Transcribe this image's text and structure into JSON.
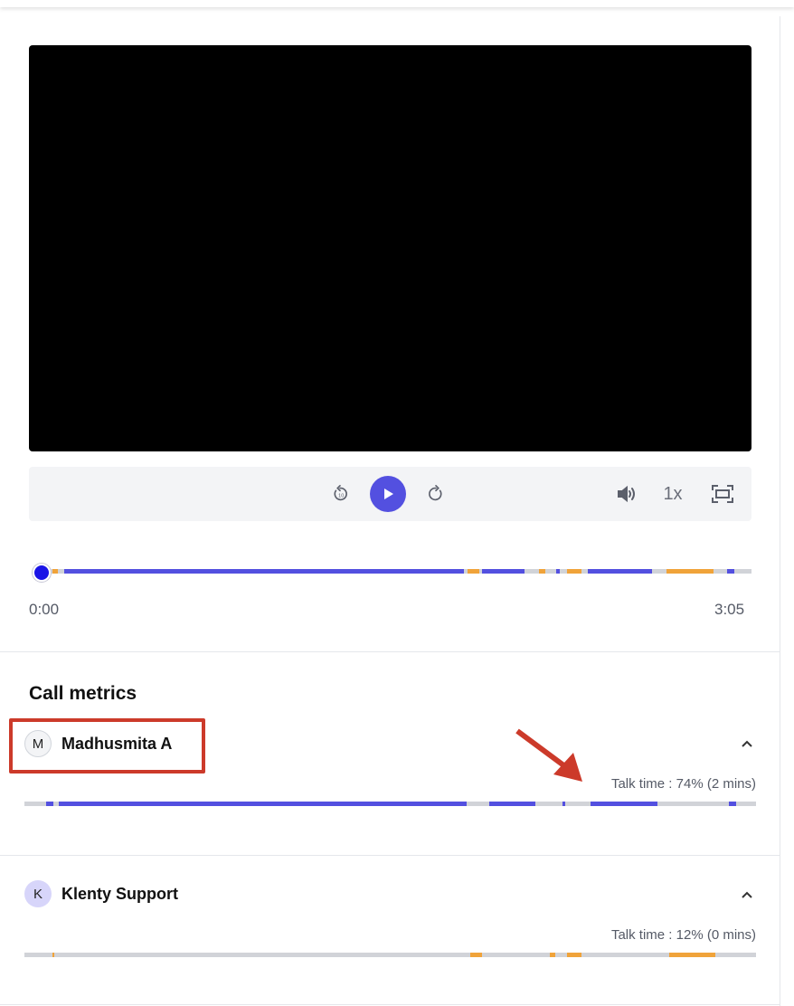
{
  "player": {
    "speed_label": "1x",
    "time_start": "0:00",
    "time_end": "3:05",
    "progress_position_fraction": 0.0,
    "icons": {
      "rewind": "rewind-icon",
      "play": "play-icon",
      "forward": "forward-icon",
      "volume": "volume-icon",
      "fullscreen": "fullscreen-icon"
    }
  },
  "colors": {
    "accent": "#5350e0",
    "speaker_a": "#5350e0",
    "speaker_b": "#f0a33a",
    "silence": "#d1d3d8",
    "annotation": "#cc3a2a"
  },
  "metrics": {
    "title": "Call metrics",
    "participants": [
      {
        "initial": "M",
        "name": "Madhusmita A",
        "talk_time": "Talk time : 74% (2 mins)"
      },
      {
        "initial": "K",
        "name": "Klenty Support",
        "talk_time": "Talk time : 12% (0 mins)"
      }
    ]
  }
}
